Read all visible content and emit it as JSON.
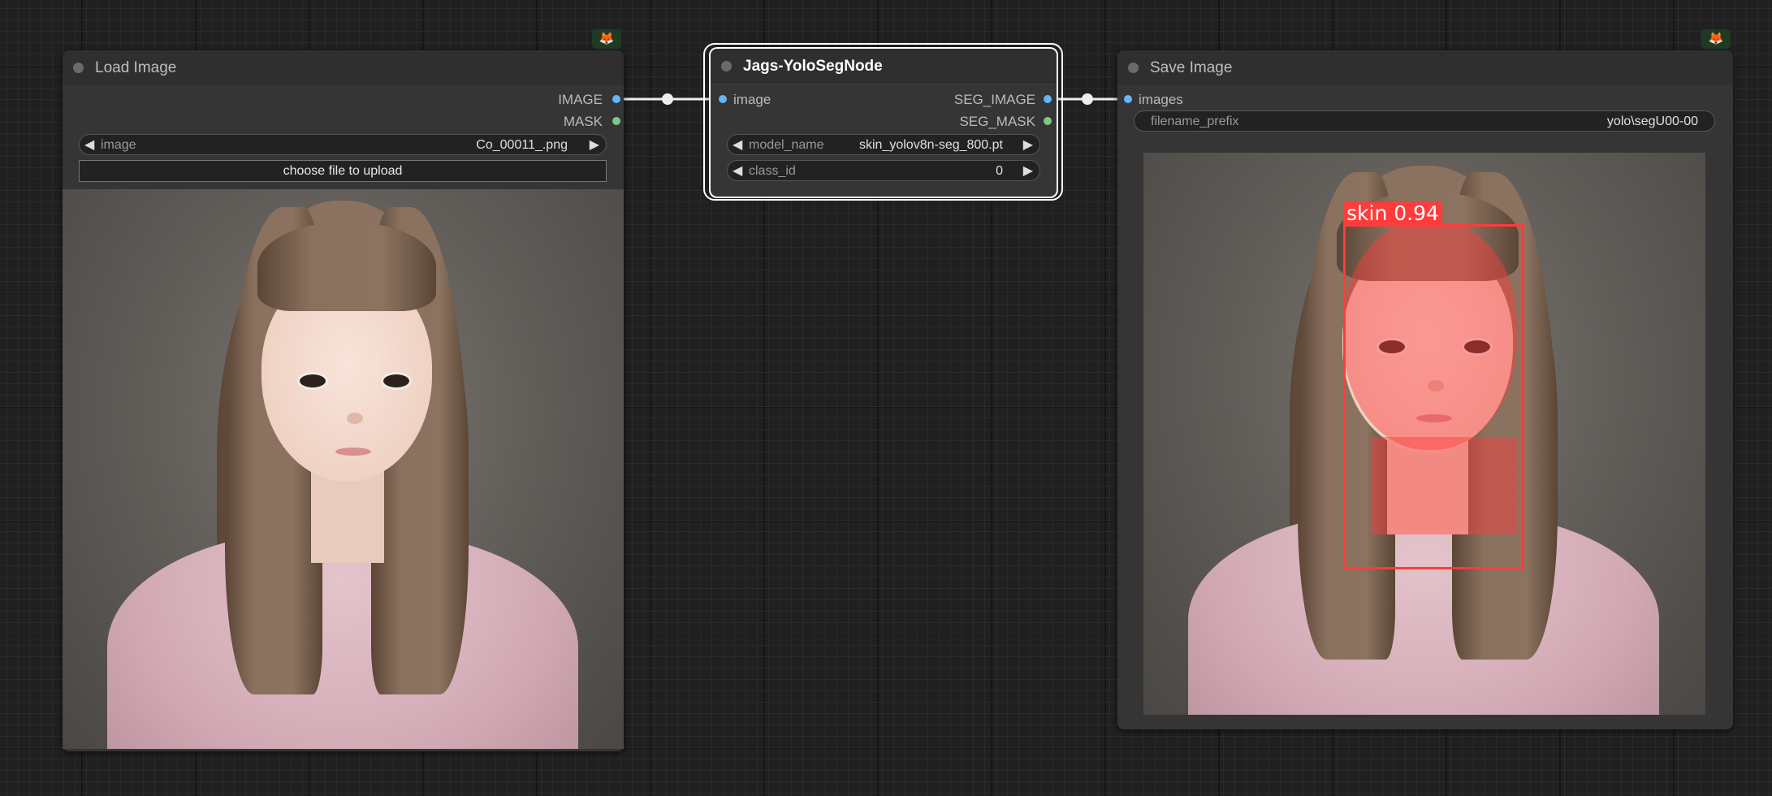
{
  "nodes": {
    "load_image": {
      "title": "Load Image",
      "outputs": [
        "IMAGE",
        "MASK"
      ],
      "image_widget": {
        "label": "image",
        "value": "Co_00011_.png"
      },
      "upload_label": "choose file to upload"
    },
    "yoloseg": {
      "title": "Jags-YoloSegNode",
      "input": "image",
      "outputs": [
        "SEG_IMAGE",
        "SEG_MASK"
      ],
      "model_widget": {
        "label": "model_name",
        "value": "skin_yolov8n-seg_800.pt"
      },
      "class_widget": {
        "label": "class_id",
        "value": "0"
      }
    },
    "save_image": {
      "title": "Save Image",
      "input": "images",
      "prefix_widget": {
        "label": "filename_prefix",
        "value": "yolo\\segU00-00"
      },
      "detection_label": "skin  0.94"
    }
  },
  "icons": {
    "arrow_left": "◀",
    "arrow_right": "▶",
    "badge": "🦊"
  },
  "colors": {
    "image_slot": "#64b5f6",
    "mask_slot": "#81c784",
    "detection": "#ff3b3b"
  }
}
